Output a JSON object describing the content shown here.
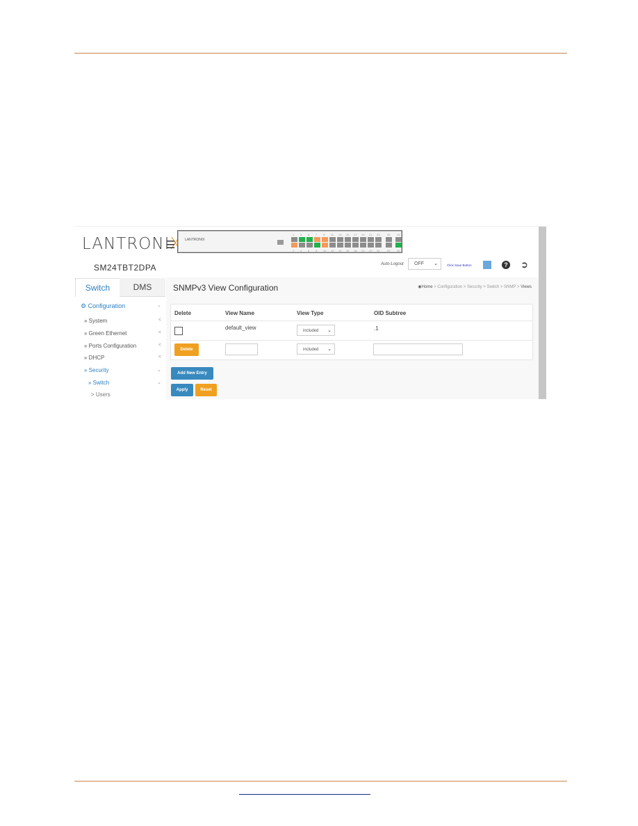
{
  "brand": {
    "logo": "LANTRONIX",
    "model": "SM24TBT2DPA",
    "panel_logo": "LANTRONIX"
  },
  "ports": {
    "top_labels": [
      "1",
      "3",
      "5",
      "7",
      "9",
      "11",
      "13",
      "15",
      "17",
      "19",
      "21",
      "23",
      "25",
      "26"
    ],
    "bottom_labels": [
      "2",
      "4",
      "6",
      "8",
      "10",
      "12",
      "14",
      "16",
      "18",
      "20",
      "22",
      "24",
      "25",
      "26"
    ],
    "top_status": [
      "gray",
      "green",
      "green",
      "orange",
      "orange",
      "gray",
      "gray",
      "gray",
      "gray",
      "gray",
      "gray",
      "gray",
      "gray",
      "gray"
    ],
    "bottom_status": [
      "orange",
      "gray",
      "gray",
      "green",
      "orange",
      "gray",
      "gray",
      "gray",
      "gray",
      "gray",
      "gray",
      "gray",
      "gray",
      "green"
    ],
    "colors": {
      "gray": "#8c8c8c",
      "green": "#22b14c",
      "orange": "#f39a5a"
    }
  },
  "header": {
    "auto_logout_label": "Auto-Logout",
    "auto_logout_value": "OFF",
    "save_hint": "Click Save Button"
  },
  "tabs": [
    {
      "label": "Switch"
    },
    {
      "label": "DMS"
    }
  ],
  "sidebar": {
    "items": [
      {
        "label": "Configuration"
      },
      {
        "label": "» System"
      },
      {
        "label": "» Green Ethernet"
      },
      {
        "label": "» Ports Configuration"
      },
      {
        "label": "» DHCP"
      },
      {
        "label": "» Security"
      },
      {
        "label": "» Switch"
      },
      {
        "label": "> Users"
      }
    ]
  },
  "main": {
    "title": "SNMPv3 View Configuration",
    "breadcrumb": [
      "Home",
      "Configuration",
      "Security",
      "Switch",
      "SNMP",
      "Views"
    ],
    "columns": [
      "Delete",
      "View Name",
      "View Type",
      "OID Subtree"
    ],
    "rows": [
      {
        "view_name": "default_view",
        "view_type": "included",
        "oid": ".1"
      }
    ],
    "new_row": {
      "delete_label": "Delete",
      "view_type": "included",
      "view_name": "",
      "oid": ""
    },
    "add_label": "Add New Entry",
    "apply_label": "Apply",
    "reset_label": "Reset"
  },
  "accent": "#f0a020",
  "link_blue": "#3889be"
}
